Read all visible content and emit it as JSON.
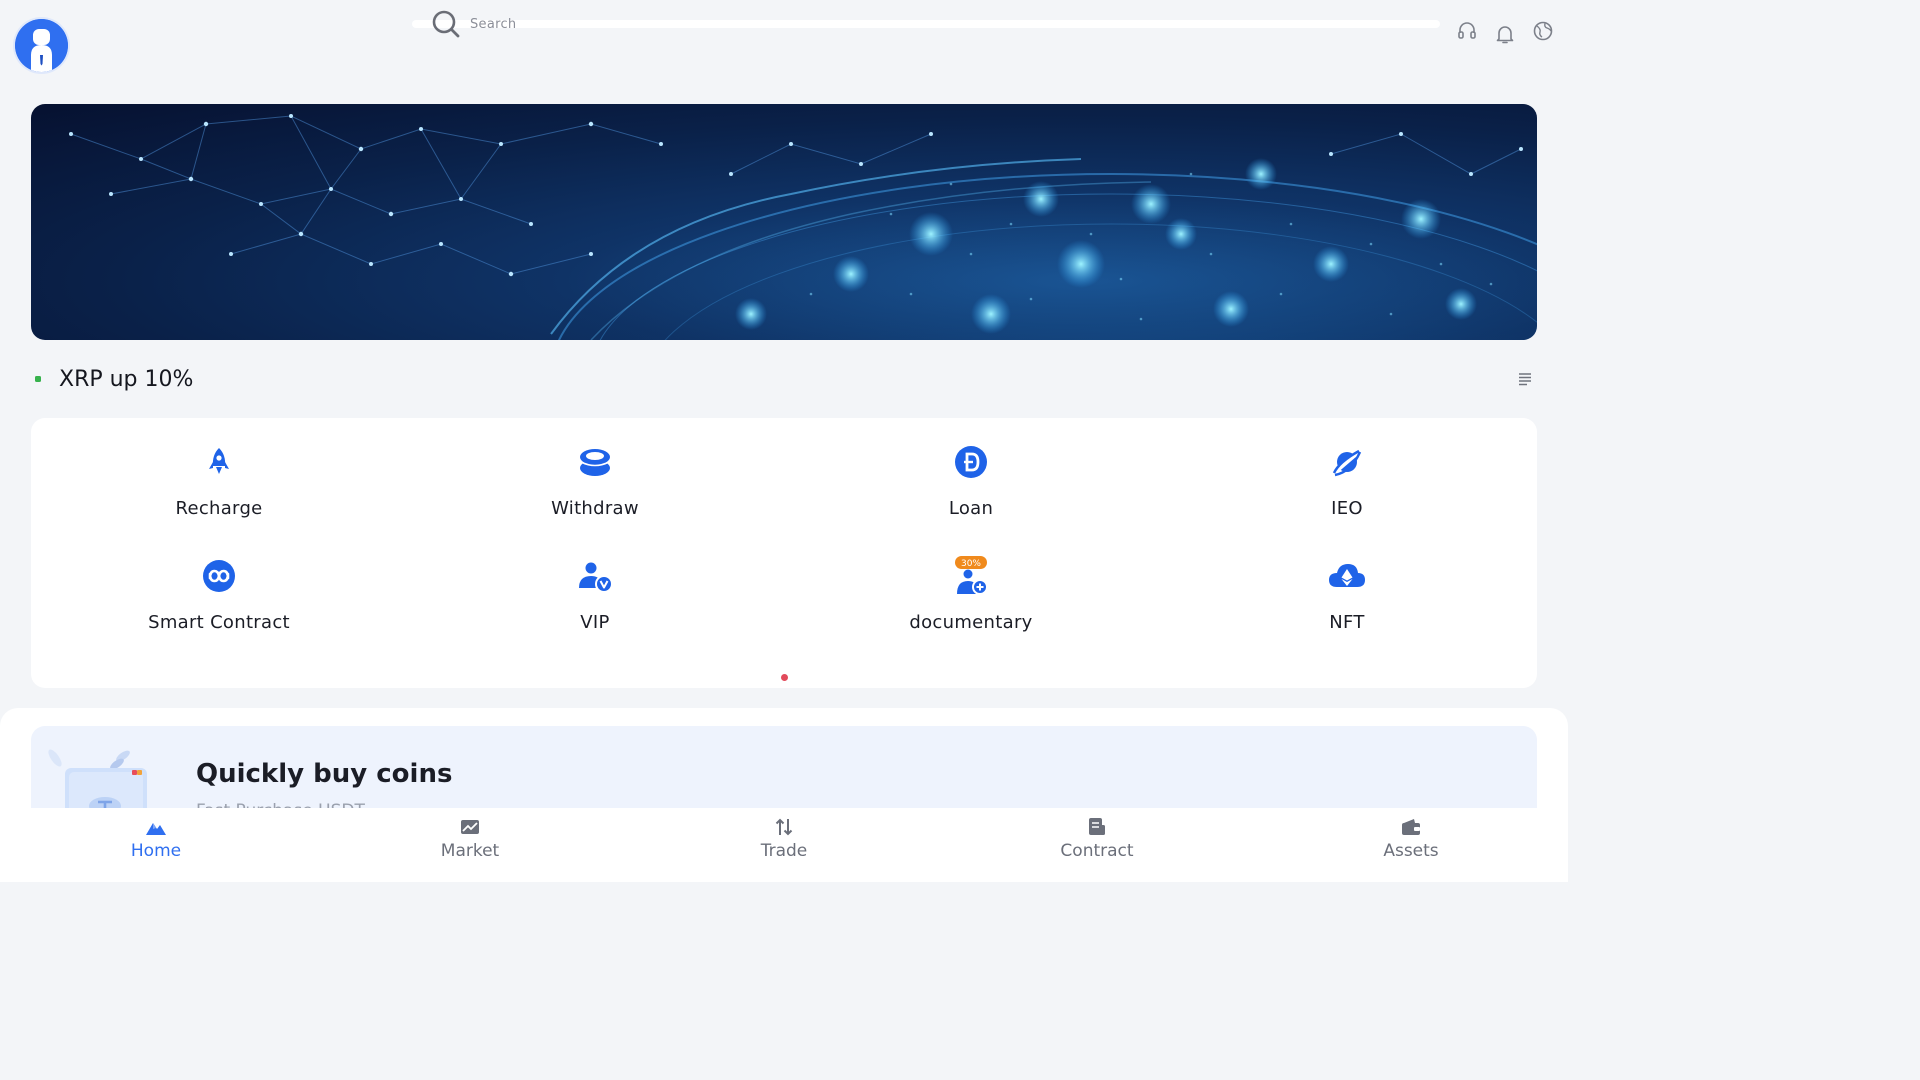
{
  "header": {
    "search_placeholder": "Search",
    "icons": [
      "headset-icon",
      "bell-icon",
      "globe-icon"
    ]
  },
  "banner": {
    "alt": ""
  },
  "notice": {
    "text": "XRP up 10%",
    "dot_color": "#37b24d"
  },
  "menu": {
    "items": [
      {
        "label": "Recharge",
        "icon": "rocket-icon"
      },
      {
        "label": "Withdraw",
        "icon": "coins-stack-icon"
      },
      {
        "label": "Loan",
        "icon": "dogecoin-icon"
      },
      {
        "label": "IEO",
        "icon": "planet-icon"
      },
      {
        "label": "Smart Contract",
        "icon": "contract-chain-icon"
      },
      {
        "label": "VIP",
        "icon": "vip-user-icon"
      },
      {
        "label": "documentary",
        "icon": "add-user-icon",
        "badge": "30%"
      },
      {
        "label": "NFT",
        "icon": "cloud-eth-icon"
      }
    ]
  },
  "buy_coins": {
    "title": "Quickly buy coins",
    "subtitle": "Fast Purchase USDT"
  },
  "tabbar": {
    "tabs": [
      {
        "label": "Home",
        "icon": "home-mountain-icon",
        "active": true
      },
      {
        "label": "Market",
        "icon": "chart-icon",
        "active": false
      },
      {
        "label": "Trade",
        "icon": "trade-arrows-icon",
        "active": false
      },
      {
        "label": "Contract",
        "icon": "contract-doc-icon",
        "active": false
      },
      {
        "label": "Assets",
        "icon": "wallet-icon",
        "active": false
      }
    ]
  },
  "colors": {
    "accent": "#2f6ff0",
    "background": "#f3f5f8",
    "active_tab": "#2f6ff0",
    "badge": "#f08a1c",
    "page_dot": "#e24a5b"
  }
}
